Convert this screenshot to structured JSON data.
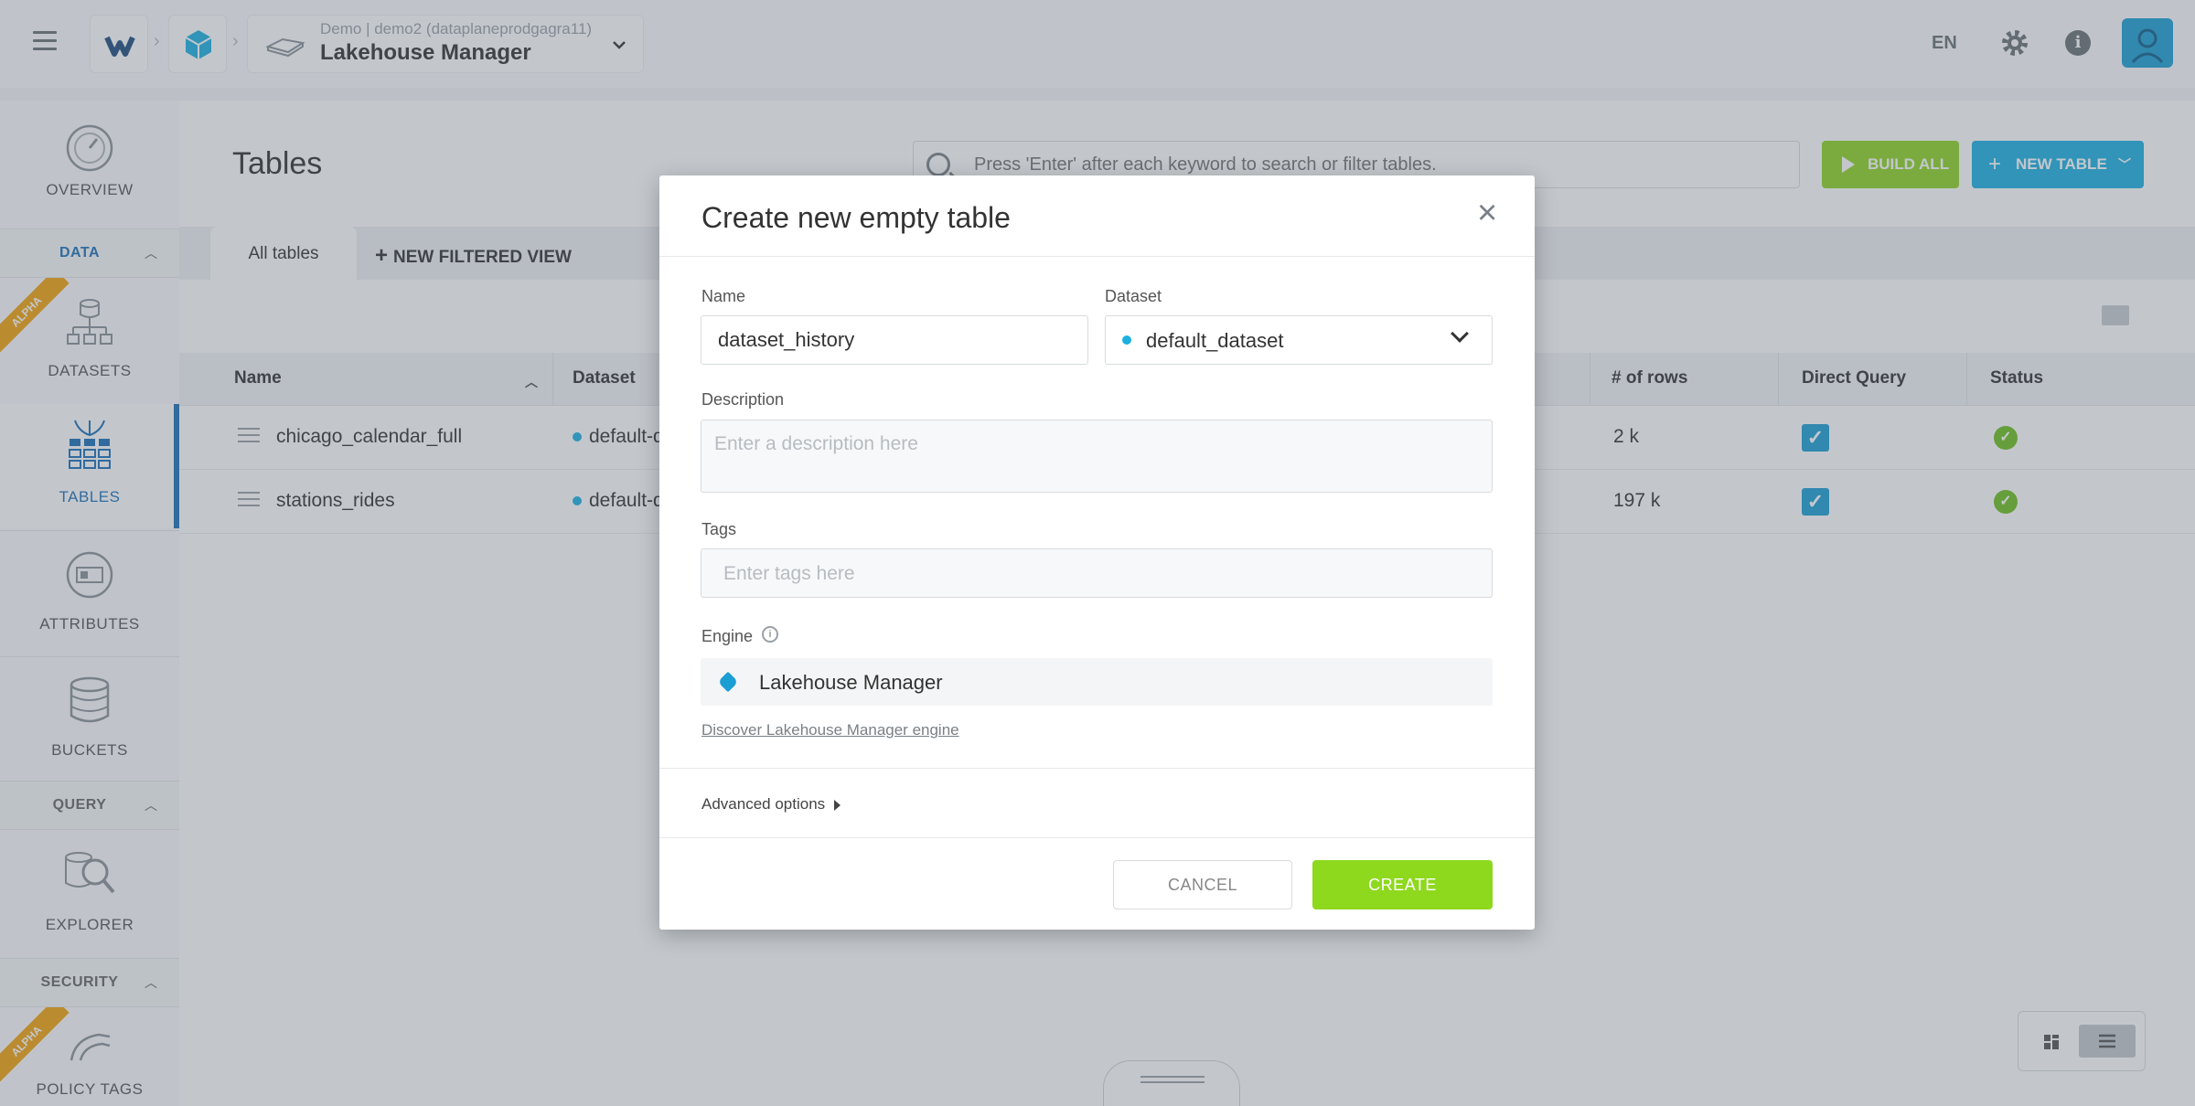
{
  "header": {
    "project_subtitle": "Demo | demo2 (dataplaneprodgagra11)",
    "project_title": "Lakehouse Manager",
    "language": "EN"
  },
  "sidebar": {
    "items": [
      {
        "label": "OVERVIEW"
      },
      {
        "label": "DATASETS"
      },
      {
        "label": "TABLES"
      },
      {
        "label": "ATTRIBUTES"
      },
      {
        "label": "BUCKETS"
      },
      {
        "label": "EXPLORER"
      },
      {
        "label": "POLICY TAGS"
      }
    ],
    "sections": [
      "DATA",
      "QUERY",
      "SECURITY"
    ],
    "alpha_badge": "ALPHA"
  },
  "main": {
    "title": "Tables",
    "search_placeholder": "Press 'Enter' after each keyword to search or filter tables.",
    "build_all_label": "BUILD ALL",
    "new_table_label": "NEW TABLE",
    "tabs": {
      "active": "All tables",
      "new_view": "NEW FILTERED VIEW"
    },
    "columns": [
      "Name",
      "Dataset",
      "# of rows",
      "Direct Query",
      "Status"
    ],
    "rows": [
      {
        "name": "chicago_calendar_full",
        "dataset": "default-d",
        "rows": "2 k",
        "direct_query": true
      },
      {
        "name": "stations_rides",
        "dataset": "default-d",
        "rows": "197 k",
        "direct_query": true
      }
    ]
  },
  "modal": {
    "title": "Create new empty table",
    "name_label": "Name",
    "name_value": "dataset_history",
    "dataset_label": "Dataset",
    "dataset_value": "default_dataset",
    "description_label": "Description",
    "description_placeholder": "Enter a description here",
    "tags_label": "Tags",
    "tags_placeholder": "Enter tags here",
    "engine_label": "Engine",
    "engine_value": "Lakehouse Manager",
    "discover_link": "Discover Lakehouse Manager engine",
    "advanced_label": "Advanced options",
    "cancel_label": "CANCEL",
    "create_label": "CREATE"
  },
  "colors": {
    "accent_blue": "#1bb0e0",
    "accent_green": "#8ed81e",
    "alpha_orange": "#f3a20b",
    "active_nav": "#1b70b8"
  }
}
